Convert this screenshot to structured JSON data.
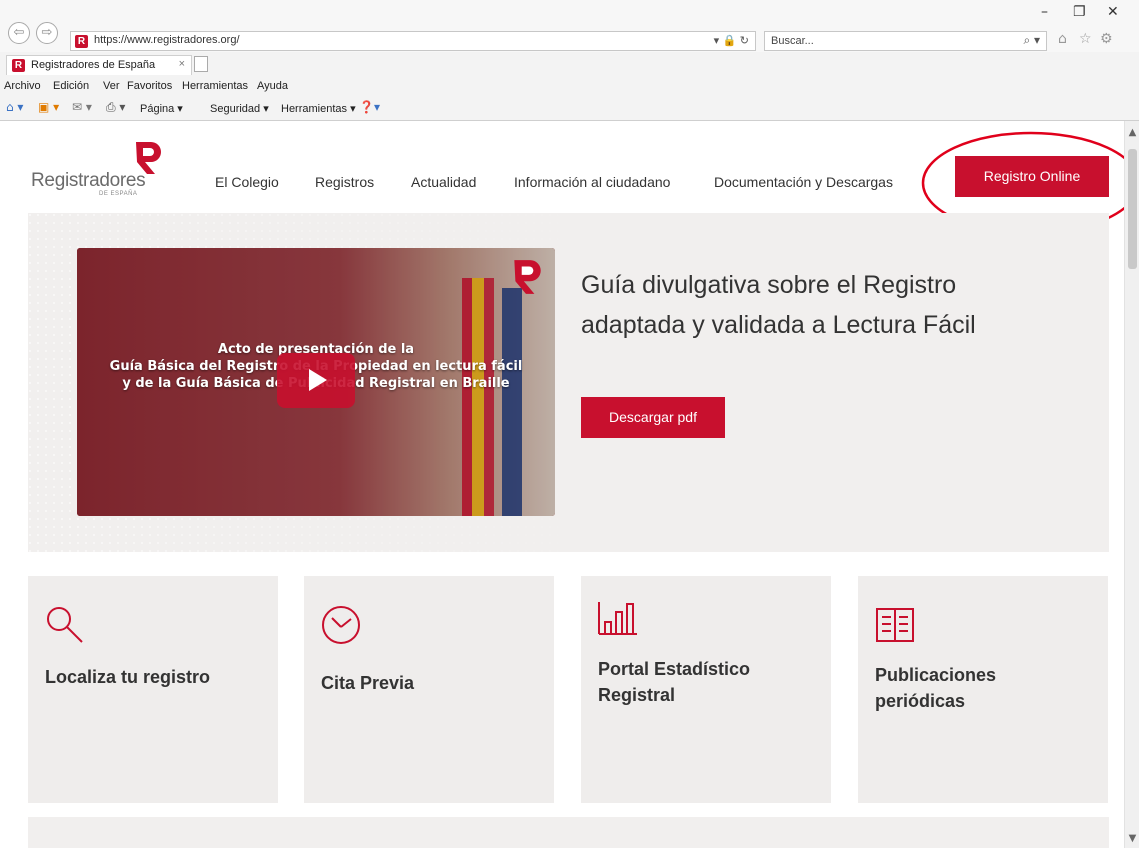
{
  "browser": {
    "url": "https://www.registradores.org/",
    "search_placeholder": "Buscar...",
    "tab_title": "Registradores de España",
    "tab_close": "×",
    "favicon_letter": "R",
    "addr_tools": "▾ 🔒 ↻",
    "search_icon": "⌕ ▾",
    "nav_back": "⇦",
    "nav_forward": "⇨",
    "win_minimize": "–",
    "win_restore": "❐",
    "win_close": "✕",
    "right_icons": {
      "home": "⌂",
      "favorites": "☆",
      "settings": "⚙"
    },
    "menu": [
      "Archivo",
      "Edición",
      "Ver",
      "Favoritos",
      "Herramientas",
      "Ayuda"
    ],
    "command_bar": {
      "home_icon": "⌂ ▾",
      "feeds_icon": "▣ ▾",
      "mail_icon": "✉ ▾",
      "print_icon": "⎙ ▾",
      "page": "Página ▾",
      "security": "Seguridad ▾",
      "tools": "Herramientas ▾",
      "help_icon": "❓▾"
    }
  },
  "site": {
    "logo": {
      "word": "Registradores",
      "sub": "DE ESPAÑA",
      "accent": "#c8102e"
    },
    "nav": [
      "El Colegio",
      "Registros",
      "Actualidad",
      "Información al ciudadano",
      "Documentación y Descargas"
    ],
    "cta_online": "Registro Online",
    "hero": {
      "video_lines": [
        "Acto de presentación de la",
        "Guía Básica del Registro de la Propiedad en lectura fácil",
        "y de la Guía Básica de Publicidad Registral en Braille"
      ],
      "title_line1": "Guía divulgativa sobre el Registro",
      "title_line2": "adaptada y validada a Lectura Fácil",
      "download_button": "Descargar pdf"
    },
    "cards": [
      {
        "line1": "Localiza tu registro",
        "line2": "",
        "icon": "magnifier-icon"
      },
      {
        "line1": "Cita Previa",
        "line2": "",
        "icon": "clock-icon"
      },
      {
        "line1": "Portal Estadístico",
        "line2": "Registral",
        "icon": "bar-chart-icon"
      },
      {
        "line1": "Publicaciones",
        "line2": "periódicas",
        "icon": "open-book-icon"
      }
    ]
  },
  "colors": {
    "brand_red": "#c8102e",
    "card_bg": "#efedec",
    "hero_bg": "#f1efee"
  }
}
